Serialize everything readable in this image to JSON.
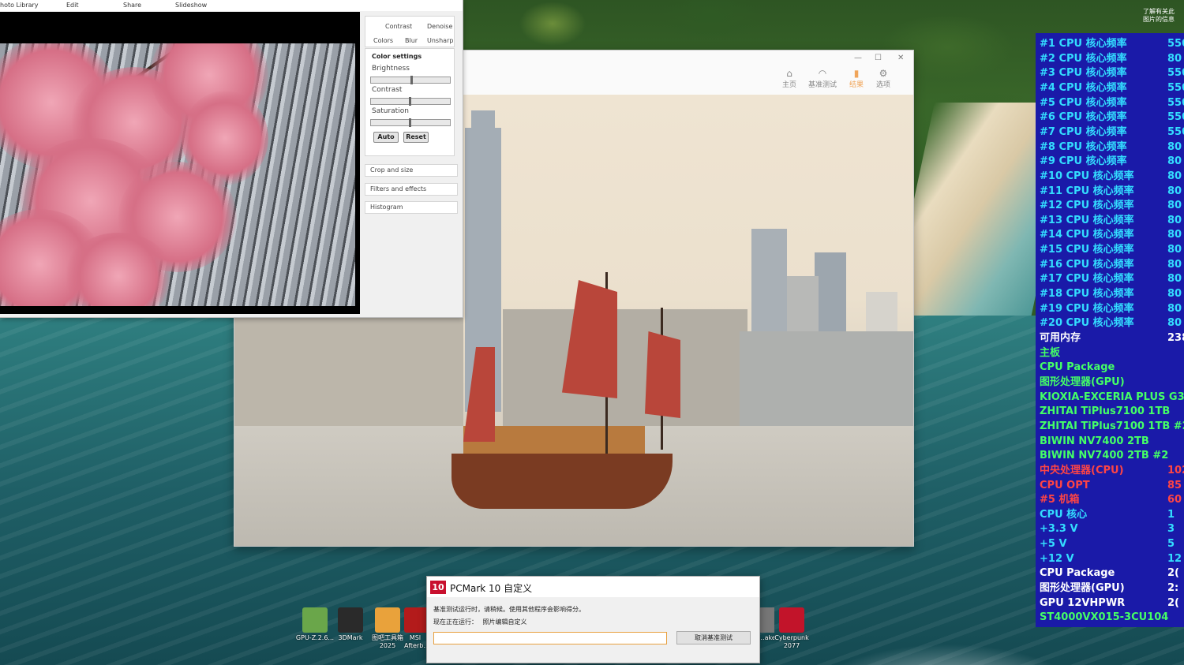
{
  "desktop": {
    "corner_text_line1": "了解有关此",
    "corner_text_line2": "图片的信息",
    "icons": [
      {
        "label": "GPU-Z.2.6...",
        "color": "#6aa64a"
      },
      {
        "label": "3DMark",
        "color": "#2a2a2a"
      },
      {
        "label": "图吧工具箱 2025",
        "color": "#e9a23b"
      },
      {
        "label": "MSI Afterb...",
        "color": "#b31b1b"
      },
      {
        "label": "...ake",
        "color": "#777777"
      },
      {
        "label": "Cyberpunk 2077",
        "color": "#c2142a"
      }
    ]
  },
  "photo_window": {
    "menu": [
      "hoto Library",
      "Edit",
      "Share",
      "Slideshow"
    ],
    "tabs": [
      "Contrast",
      "Denoise",
      "Colors",
      "Blur",
      "Unsharp"
    ],
    "color_settings": {
      "title": "Color settings",
      "sliders": [
        {
          "label": "Brightness",
          "value": 0.5
        },
        {
          "label": "Contrast",
          "value": 0.48
        },
        {
          "label": "Saturation",
          "value": 0.48
        }
      ],
      "auto_label": "Auto",
      "reset_label": "Reset"
    },
    "panels": [
      "Crop and size",
      "Filters and effects",
      "Histogram"
    ]
  },
  "pcmark_window": {
    "controls": [
      "—",
      "☐",
      "✕"
    ],
    "nav": [
      {
        "label": "主页",
        "icon": "home-icon",
        "glyph": "⌂",
        "active": false
      },
      {
        "label": "基准测试",
        "icon": "gauge-icon",
        "glyph": "◠",
        "active": false
      },
      {
        "label": "结果",
        "icon": "bar-chart-icon",
        "glyph": "▮",
        "active": true
      },
      {
        "label": "选项",
        "icon": "gear-icon",
        "glyph": "⚙",
        "active": false
      }
    ]
  },
  "monitor": {
    "accent_cyan": "#33ddff",
    "accent_green": "#44ff66",
    "accent_red": "#ff4444",
    "rows": [
      {
        "label": "#1 CPU 核心频率",
        "value": "550",
        "color": "#33ddff"
      },
      {
        "label": "#2 CPU 核心频率",
        "value": "80",
        "color": "#33ddff"
      },
      {
        "label": "#3 CPU 核心频率",
        "value": "550",
        "color": "#33ddff"
      },
      {
        "label": "#4 CPU 核心频率",
        "value": "550",
        "color": "#33ddff"
      },
      {
        "label": "#5 CPU 核心频率",
        "value": "550",
        "color": "#33ddff"
      },
      {
        "label": "#6 CPU 核心频率",
        "value": "550",
        "color": "#33ddff"
      },
      {
        "label": "#7 CPU 核心频率",
        "value": "550",
        "color": "#33ddff"
      },
      {
        "label": "#8 CPU 核心频率",
        "value": "80",
        "color": "#33ddff"
      },
      {
        "label": "#9 CPU 核心频率",
        "value": "80",
        "color": "#33ddff"
      },
      {
        "label": "#10 CPU 核心频率",
        "value": "80",
        "color": "#33ddff"
      },
      {
        "label": "#11 CPU 核心频率",
        "value": "80",
        "color": "#33ddff"
      },
      {
        "label": "#12 CPU 核心频率",
        "value": "80",
        "color": "#33ddff"
      },
      {
        "label": "#13 CPU 核心频率",
        "value": "80",
        "color": "#33ddff"
      },
      {
        "label": "#14 CPU 核心频率",
        "value": "80",
        "color": "#33ddff"
      },
      {
        "label": "#15 CPU 核心频率",
        "value": "80",
        "color": "#33ddff"
      },
      {
        "label": "#16 CPU 核心频率",
        "value": "80",
        "color": "#33ddff"
      },
      {
        "label": "#17 CPU 核心频率",
        "value": "80",
        "color": "#33ddff"
      },
      {
        "label": "#18 CPU 核心频率",
        "value": "80",
        "color": "#33ddff"
      },
      {
        "label": "#19 CPU 核心频率",
        "value": "80",
        "color": "#33ddff"
      },
      {
        "label": "#20 CPU 核心频率",
        "value": "80",
        "color": "#33ddff"
      },
      {
        "label": "可用内存",
        "value": "238",
        "color": "#ffffff"
      },
      {
        "label": "主板",
        "value": "",
        "color": "#44ff66"
      },
      {
        "label": "CPU Package",
        "value": "",
        "color": "#44ff66"
      },
      {
        "label": "图形处理器(GPU)",
        "value": "",
        "color": "#44ff66"
      },
      {
        "label": "KIOXIA-EXCERIA PLUS G3 SSD",
        "value": "",
        "color": "#44ff66"
      },
      {
        "label": "ZHITAI TiPlus7100 1TB",
        "value": "",
        "color": "#44ff66"
      },
      {
        "label": "ZHITAI TiPlus7100 1TB #2",
        "value": "",
        "color": "#44ff66"
      },
      {
        "label": "BIWIN NV7400 2TB",
        "value": "",
        "color": "#44ff66"
      },
      {
        "label": "BIWIN NV7400 2TB #2",
        "value": "",
        "color": "#44ff66"
      },
      {
        "label": "中央处理器(CPU)",
        "value": "102",
        "color": "#ff4444"
      },
      {
        "label": "CPU OPT",
        "value": "85",
        "color": "#ff4444"
      },
      {
        "label": "#5 机箱",
        "value": "60",
        "color": "#ff4444"
      },
      {
        "label": "CPU 核心",
        "value": "1",
        "color": "#33ddff"
      },
      {
        "label": "+3.3 V",
        "value": "3",
        "color": "#33ddff"
      },
      {
        "label": "+5 V",
        "value": "5",
        "color": "#33ddff"
      },
      {
        "label": "+12 V",
        "value": "12",
        "color": "#33ddff"
      },
      {
        "label": "CPU Package",
        "value": "2(",
        "color": "#ffffff"
      },
      {
        "label": "图形处理器(GPU)",
        "value": "2:",
        "color": "#ffffff"
      },
      {
        "label": "GPU 12VHPWR",
        "value": "2(",
        "color": "#ffffff"
      },
      {
        "label": "ST4000VX015-3CU104",
        "value": "",
        "color": "#44ff66"
      }
    ]
  },
  "dialog": {
    "logo": "10",
    "title": "PCMark 10 自定义",
    "message": "基准测试运行时，请稍候。使用其他程序会影响得分。",
    "running_label": "现在正在运行：",
    "running_value": "照片编辑自定义",
    "progress": 0.0,
    "cancel_label": "取消基准测试"
  }
}
